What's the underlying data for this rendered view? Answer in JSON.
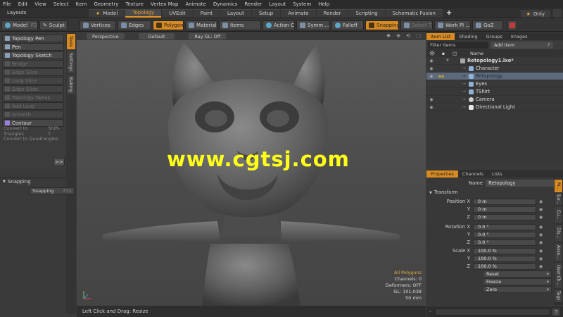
{
  "menu": [
    "File",
    "Edit",
    "View",
    "Select",
    "Item",
    "Geometry",
    "Texture",
    "Vertex Map",
    "Animate",
    "Dynamics",
    "Render",
    "Layout",
    "System",
    "Help"
  ],
  "layouts": {
    "title": "Layouts",
    "tabs": [
      {
        "label": "Model",
        "starred": true,
        "active": false
      },
      {
        "label": "Topology",
        "starred": false,
        "active": true
      },
      {
        "label": "UVEdit",
        "starred": false,
        "active": false
      },
      {
        "label": "Paint",
        "starred": false,
        "active": false
      },
      {
        "label": "Layout",
        "starred": false,
        "active": false
      },
      {
        "label": "Setup",
        "starred": false,
        "active": false
      },
      {
        "label": "Animate",
        "starred": false,
        "active": false
      },
      {
        "label": "Render",
        "starred": false,
        "active": false
      },
      {
        "label": "Scripting",
        "starred": false,
        "active": false
      },
      {
        "label": "Schematic Fusion",
        "starred": false,
        "active": false
      }
    ],
    "plus": "+",
    "only": "Only"
  },
  "toolbar": {
    "model": "Model",
    "model_shortcut": "F2",
    "sculpt": "Sculpt",
    "vertices": "Vertices",
    "edges": "Edges",
    "polygons": "Polygons",
    "materials": "Materials",
    "items": "Items",
    "action_center": "Action C...",
    "symmetry": "Symm ...",
    "falloff": "Falloff",
    "snapping": "Snapping",
    "select_through": "Select T...",
    "work_plane": "Work Pl ...",
    "goz": "GoZ"
  },
  "tools": {
    "items": [
      {
        "label": "Topology Pen",
        "enabled": true,
        "shortcut": ""
      },
      {
        "label": "Pen",
        "enabled": true,
        "shortcut": ""
      },
      {
        "label": "Topology Sketch",
        "enabled": true,
        "shortcut": ""
      },
      {
        "label": "Bridge",
        "enabled": false,
        "shortcut": ""
      },
      {
        "label": "Edge Slice",
        "enabled": false,
        "shortcut": ""
      },
      {
        "label": "Loop Slice",
        "enabled": false,
        "shortcut": ""
      },
      {
        "label": "Edge Slide",
        "enabled": false,
        "shortcut": ""
      },
      {
        "label": "Topology Tweak",
        "enabled": false,
        "shortcut": ""
      },
      {
        "label": "Add Loop",
        "enabled": false,
        "shortcut": ""
      },
      {
        "label": "Smooth",
        "enabled": false,
        "shortcut": ""
      },
      {
        "label": "Contour",
        "enabled": true,
        "shortcut": ""
      }
    ],
    "convert_triangles": "Convert to Triangles",
    "convert_triangles_shortcut": "Shift-T",
    "convert_quadrangles": "Convert to Quadrangles",
    "expand": ">>"
  },
  "side_tabs": [
    "Tools",
    "Settings",
    "Baking"
  ],
  "snapping_panel": {
    "header": "Snapping",
    "button": "Snapping",
    "shortcut": "F11"
  },
  "viewport": {
    "view": "Perspective",
    "style": "Default",
    "raygl": "Ray GL: Off",
    "watermark": "www.cgtsj.com",
    "stats": {
      "selection": "All Polygons",
      "channels": "Channels: 0",
      "deformers": "Deformers: OFF",
      "gl": "GL: 101,038",
      "focal": "50 mm"
    }
  },
  "status": "Left Click and Drag:  Resize",
  "item_list": {
    "tabs": [
      "Item List",
      "Shading",
      "Groups",
      "Images"
    ],
    "filter": "Filter Items",
    "add_item": "Add Item",
    "add_item_shortcut": "F",
    "col_name": "Name",
    "rows": [
      {
        "name": "Retopology1.lxo*",
        "bold": true,
        "visible": true,
        "selected": false,
        "icon": "scene",
        "indent": 0
      },
      {
        "name": "Character",
        "bold": false,
        "visible": true,
        "selected": false,
        "icon": "mesh",
        "indent": 1
      },
      {
        "name": "Retopology",
        "bold": false,
        "visible": true,
        "selected": true,
        "icon": "mesh",
        "indent": 1
      },
      {
        "name": "Eyes",
        "bold": false,
        "visible": false,
        "selected": false,
        "icon": "mesh",
        "indent": 1
      },
      {
        "name": "TShirt",
        "bold": false,
        "visible": false,
        "selected": false,
        "icon": "mesh",
        "indent": 1
      },
      {
        "name": "Camera",
        "bold": false,
        "visible": true,
        "selected": false,
        "icon": "camera",
        "indent": 1
      },
      {
        "name": "Directional Light",
        "bold": false,
        "visible": true,
        "selected": false,
        "icon": "light",
        "indent": 1
      }
    ]
  },
  "properties": {
    "tabs": [
      "Properties",
      "Channels",
      "Lists"
    ],
    "name_label": "Name",
    "name_value": "Retopology",
    "section": "Transform",
    "rows": [
      {
        "label": "Position X",
        "value": "0 m"
      },
      {
        "label": "Y",
        "value": "0 m"
      },
      {
        "label": "Z",
        "value": "0 m"
      },
      {
        "label": "Rotation X",
        "value": "0.0 °"
      },
      {
        "label": "Y",
        "value": "0.0 °"
      },
      {
        "label": "Z",
        "value": "0.0 °"
      },
      {
        "label": "Scale X",
        "value": "100.0 %"
      },
      {
        "label": "Y",
        "value": "100.0 %"
      },
      {
        "label": "Z",
        "value": "100.0 %"
      }
    ],
    "actions": [
      "Reset",
      "Freeze",
      "Zero"
    ]
  },
  "right_tabs": [
    "M...",
    "Sur...",
    "Cu...",
    "Dis...",
    "Asse...",
    "User Ch...",
    "Tags"
  ],
  "colors": {
    "accent": "#d88a22",
    "watermark": "#ffff1a",
    "selection_row": "#5d6a7b"
  }
}
